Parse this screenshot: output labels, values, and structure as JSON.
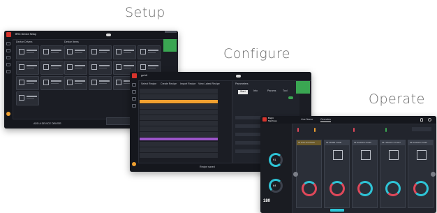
{
  "headings": {
    "setup": "Setup",
    "configure": "Configure",
    "operate": "Operate"
  },
  "setup_screen": {
    "title": "BRC Device Setup",
    "section_left": "Device Drivers",
    "section_right": "Device Items",
    "footer_button": "ADD A DEVICE DRIVER"
  },
  "configure_screen": {
    "title": "go.bit",
    "menu": [
      "Select Recipe",
      "Create Recipe",
      "Import Recipe",
      "View Latest Recipe"
    ],
    "panel_title": "Parameters",
    "panel_tabs": [
      "Start",
      "Info",
      "Params",
      "Tool"
    ],
    "status_text": "Recipe saved"
  },
  "operate_screen": {
    "brand_line1": "Bright",
    "brand_line2": "Machines",
    "tabs": [
      "Line Name",
      "Overview"
    ],
    "kpi_left": "91",
    "kpi_left2": "64",
    "kpi_big": "180",
    "tiles": [
      "01 Pick and Place",
      "02 ODMR Install",
      "03 Heatsink Install",
      "04 Labelers & Laser",
      "05 Heatsink Install"
    ],
    "tile_value": "22"
  },
  "colors": {
    "accent_red": "#d8342c",
    "accent_green": "#3aa652",
    "gauge_cyan": "#2ec4d6",
    "gauge_red": "#e0485a",
    "bar_orange": "#f0a030",
    "bar_purple": "#9b55c9"
  }
}
